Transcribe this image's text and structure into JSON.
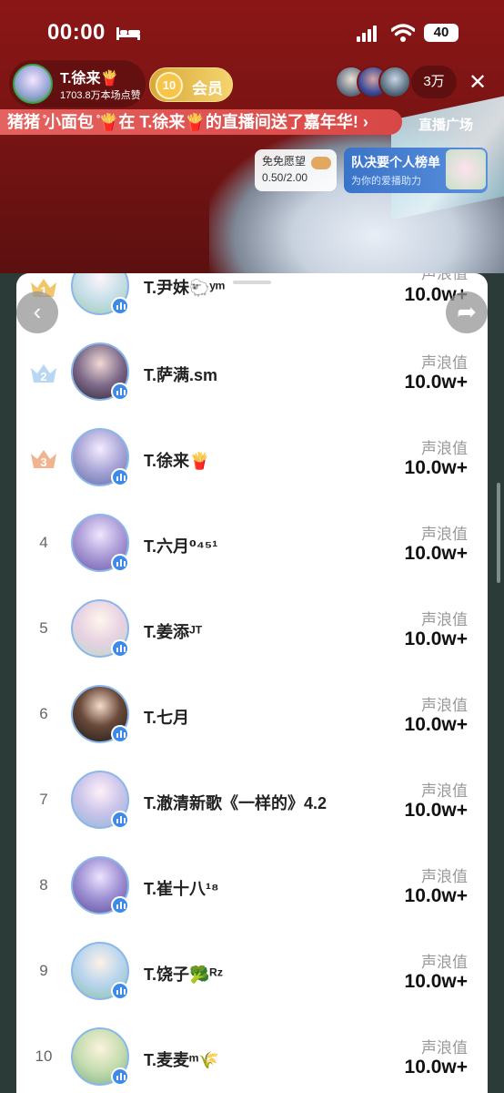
{
  "status_bar": {
    "time": "00:00",
    "battery": "40"
  },
  "header": {
    "host_name": "T.徐来🍟",
    "host_likes": "1703.8万本场点赞",
    "fan_level": "10",
    "fan_label": "会员",
    "viewer_count": "3万"
  },
  "banner": {
    "text": "猪猪 ̊小面包 ̊🍟在 T.徐来🍟的直播间送了嘉年华! ›",
    "square_label": "直播广场"
  },
  "widgets": {
    "wish_title": "免免愿望",
    "wish_value": "0.50/2.00",
    "team_title": "队决要个人榜单",
    "team_sub": "为你的爱播助力"
  },
  "colors": {
    "crown_gold": "#f2c56b",
    "crown_silver": "#b9d6f2",
    "crown_bronze": "#f0b48e",
    "badge_blue": "#3d8ae8"
  },
  "ranking": {
    "value_label": "声浪值",
    "rows": [
      {
        "rank": "1",
        "name": "T.尹妹🐑ʸᵐ",
        "value": "10.0w+",
        "value_label": "声浪值"
      },
      {
        "rank": "2",
        "name": "T.萨满.sm",
        "value": "10.0w+",
        "value_label": "声浪值"
      },
      {
        "rank": "3",
        "name": "T.徐来🍟",
        "value": "10.0w+",
        "value_label": "声浪值"
      },
      {
        "rank": "4",
        "name": "T.六月⁰⁴⁵¹",
        "value": "10.0w+",
        "value_label": "声浪值"
      },
      {
        "rank": "5",
        "name": "T.姜添ᴶᵀ",
        "value": "10.0w+",
        "value_label": "声浪值"
      },
      {
        "rank": "6",
        "name": "T.七月",
        "value": "10.0w+",
        "value_label": "声浪值"
      },
      {
        "rank": "7",
        "name": "T.澈清新歌《一样的》4.2",
        "value": "10.0w+",
        "value_label": "声浪值"
      },
      {
        "rank": "8",
        "name": "T.崔十八¹⁸",
        "value": "10.0w+",
        "value_label": "声浪值"
      },
      {
        "rank": "9",
        "name": "T.饶子🥦ᴿᶻ",
        "value": "10.0w+",
        "value_label": "声浪值"
      },
      {
        "rank": "10",
        "name": "T.麦麦ᵐ🌾",
        "value": "10.0w+",
        "value_label": "声浪值"
      }
    ]
  }
}
